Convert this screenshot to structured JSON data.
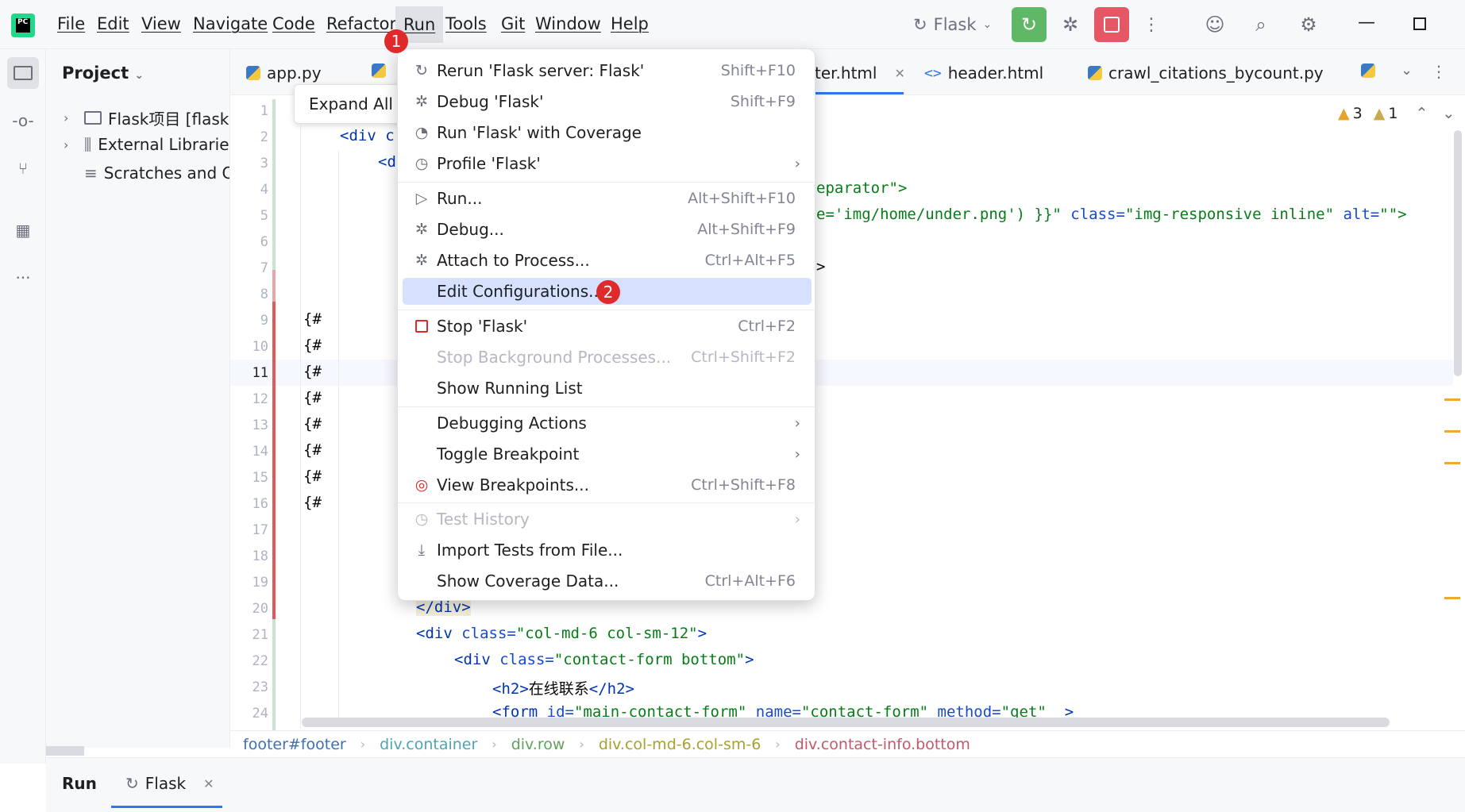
{
  "menubar": {
    "items": [
      "File",
      "Edit",
      "View",
      "Navigate",
      "Code",
      "Refactor",
      "Run",
      "Tools",
      "Git",
      "Window",
      "Help"
    ],
    "active": "Run"
  },
  "run_config": {
    "name": "Flask"
  },
  "badges": {
    "run_menu": "1",
    "edit_config": "2"
  },
  "project": {
    "title": "Project",
    "tree": [
      {
        "label": "Flask项目 [flaskl",
        "expandable": true
      },
      {
        "label": "External Librarie",
        "expandable": true
      },
      {
        "label": "Scratches and C",
        "expandable": false
      }
    ]
  },
  "tooltip": {
    "label": "Expand All"
  },
  "tabs": [
    {
      "label": "app.py",
      "icon": "python-icon"
    },
    {
      "label": "ter.html",
      "icon": "html-icon",
      "active": true
    },
    {
      "label": "header.html",
      "icon": "html-icon"
    },
    {
      "label": "crawl_citations_bycount.py",
      "icon": "python-icon"
    }
  ],
  "inspections": {
    "warnings": "3",
    "weak_warnings": "1"
  },
  "run_menu": [
    {
      "label": "Rerun 'Flask server: Flask'",
      "shortcut": "Shift+F10",
      "icon": "rerun-icon"
    },
    {
      "label": "Debug 'Flask'",
      "shortcut": "Shift+F9",
      "icon": "debug-icon"
    },
    {
      "label": "Run 'Flask' with Coverage",
      "shortcut": "",
      "icon": "coverage-icon"
    },
    {
      "label": "Profile 'Flask'",
      "shortcut": "",
      "icon": "profile-icon",
      "submenu": true
    },
    {
      "label": "Run...",
      "shortcut": "Alt+Shift+F10",
      "icon": "run-icon"
    },
    {
      "label": "Debug...",
      "shortcut": "Alt+Shift+F9",
      "icon": "debug-icon"
    },
    {
      "label": "Attach to Process...",
      "shortcut": "Ctrl+Alt+F5",
      "icon": "attach-icon"
    },
    {
      "label": "Edit Configurations...",
      "shortcut": "",
      "icon": "",
      "selected": true
    },
    {
      "label": "Stop 'Flask'",
      "shortcut": "Ctrl+F2",
      "icon": "stop-icon"
    },
    {
      "label": "Stop Background Processes...",
      "shortcut": "Ctrl+Shift+F2",
      "icon": "",
      "disabled": true
    },
    {
      "label": "Show Running List",
      "shortcut": "",
      "icon": ""
    },
    {
      "label": "Debugging Actions",
      "shortcut": "",
      "icon": "",
      "submenu": true
    },
    {
      "label": "Toggle Breakpoint",
      "shortcut": "",
      "icon": "",
      "submenu": true
    },
    {
      "label": "View Breakpoints...",
      "shortcut": "Ctrl+Shift+F8",
      "icon": "breakpoints-icon"
    },
    {
      "label": "Test History",
      "shortcut": "",
      "icon": "history-icon",
      "submenu": true,
      "disabled": true
    },
    {
      "label": "Import Tests from File...",
      "shortcut": "",
      "icon": "import-icon"
    },
    {
      "label": "Show Coverage Data...",
      "shortcut": "Ctrl+Alt+F6",
      "icon": ""
    }
  ],
  "gutter": [
    "1",
    "2",
    "3",
    "4",
    "5",
    "6",
    "7",
    "8",
    "9",
    "10",
    "11",
    "12",
    "13",
    "14",
    "15",
    "16",
    "17",
    "18",
    "19",
    "20",
    "21",
    "22",
    "23",
    "24"
  ],
  "code_fragments": {
    "l2": "<div c",
    "l3": "<d",
    "l4": "eparator\">",
    "l5a": "e='img/home/under.png') }}\"",
    "l5b": " class=",
    "l5c": "\"img-responsive inline\"",
    "l5d": " alt=",
    "l5e": "\"\">",
    "l7": ">",
    "hash": "{#",
    "l20": "</div>",
    "l21a": "<div",
    "l21b": " class=",
    "l21c": "\"col-md-6 col-sm-12\"",
    "l21d": ">",
    "l22a": "<div",
    "l22b": " class=",
    "l22c": "\"contact-form bottom\"",
    "l22d": ">",
    "l23a": "<h2>",
    "l23b": "在线联系",
    "l23c": "</h2>",
    "l24a": "<form",
    "l24b": " id=",
    "l24c": "\"main-contact-form\"",
    "l24d": " name=",
    "l24e": "\"contact-form\"",
    "l24f": " method=",
    "l24g": "\"get\"",
    "l24h": "  >"
  },
  "breadcrumb": [
    "footer#footer",
    "div.container",
    "div.row",
    "div.col-md-6.col-sm-6",
    "div.contact-info.bottom"
  ],
  "run_panel": {
    "title": "Run",
    "tab": "Flask"
  }
}
